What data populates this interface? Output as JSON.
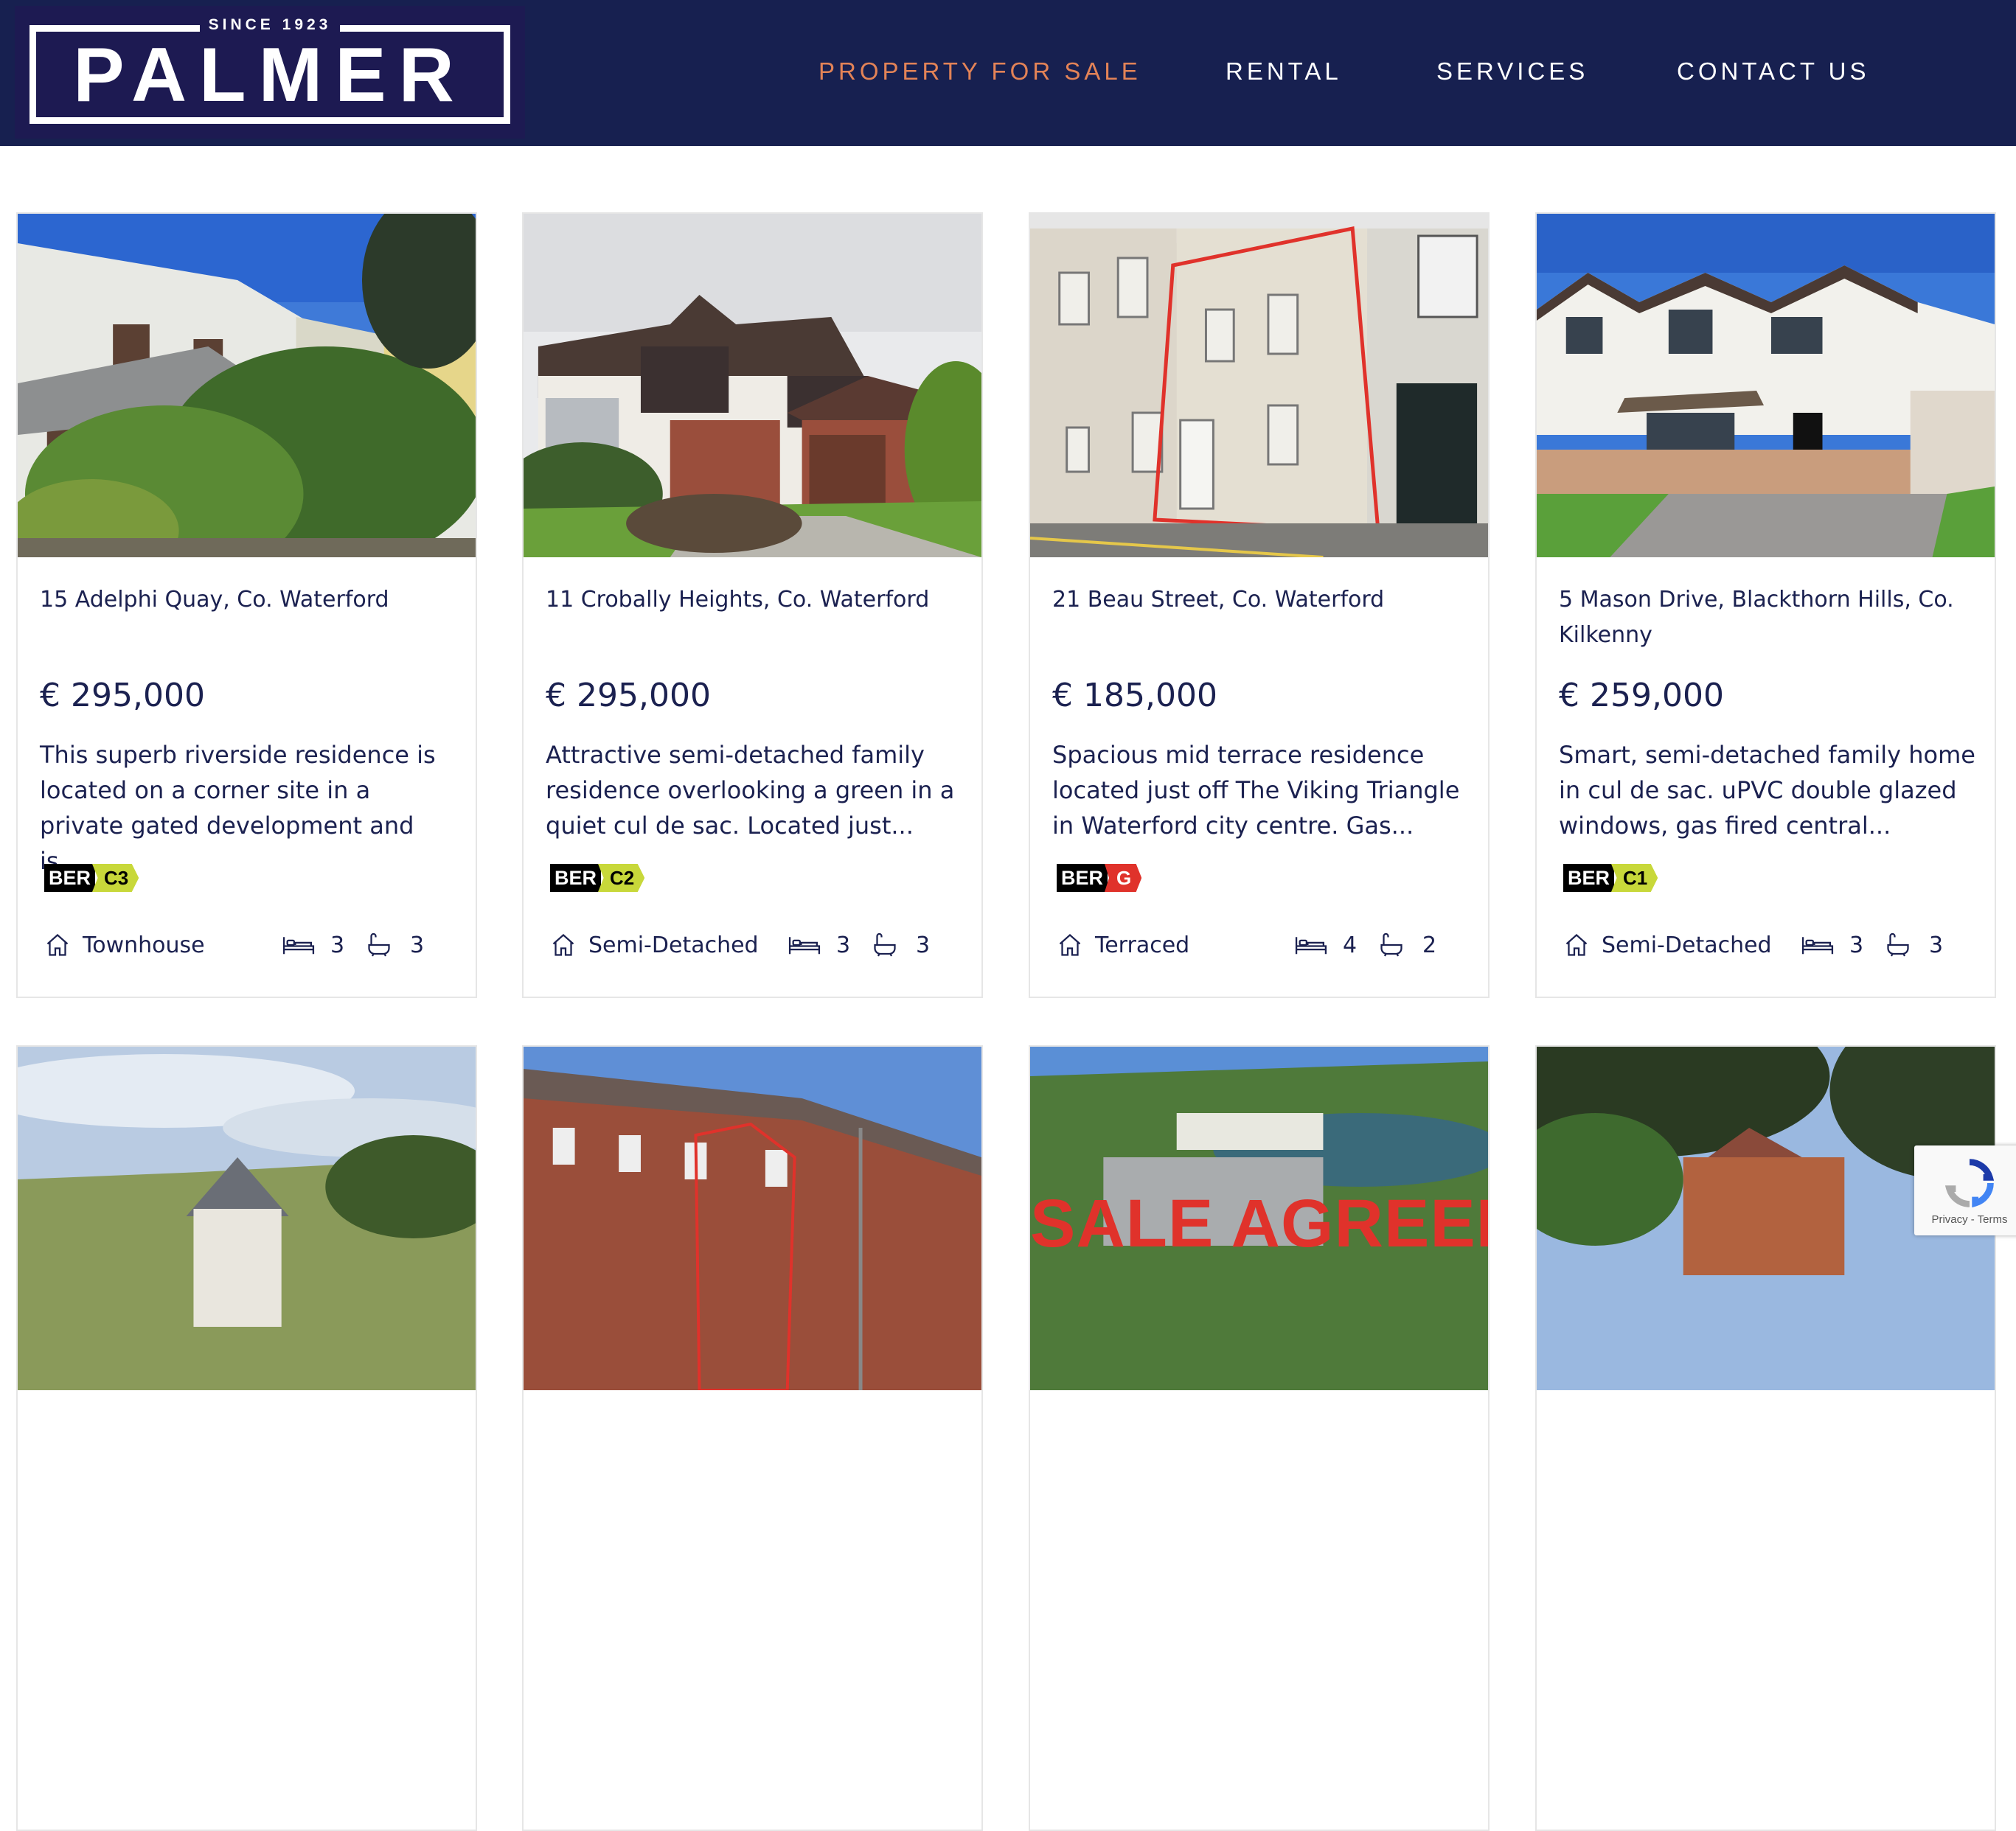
{
  "brand": {
    "name": "PALMER",
    "since": "SINCE 1923"
  },
  "nav": {
    "items": [
      {
        "label": "PROPERTY FOR SALE",
        "active": true
      },
      {
        "label": "RENTAL",
        "active": false
      },
      {
        "label": "SERVICES",
        "active": false
      },
      {
        "label": "CONTACT US",
        "active": false
      }
    ]
  },
  "colors": {
    "header_bg": "#172050",
    "active_nav": "#e38357",
    "text": "#1b2150"
  },
  "listings": [
    {
      "address": "15 Adelphi Quay, Co. Waterford",
      "price": "€ 295,000",
      "description": "This superb riverside residence is located on a corner site in a private gated development and is...",
      "ber_label": "BER",
      "ber_rating": "C3",
      "ber_color": "#c8d83a",
      "type": "Townhouse",
      "beds": "3",
      "baths": "3"
    },
    {
      "address": "11 Crobally Heights, Co. Waterford",
      "price": "€ 295,000",
      "description": "Attractive semi-detached family residence overlooking a green in a quiet cul de sac. Located just...",
      "ber_label": "BER",
      "ber_rating": "C2",
      "ber_color": "#c8d83a",
      "type": "Semi-Detached",
      "beds": "3",
      "baths": "3"
    },
    {
      "address": "21 Beau Street, Co. Waterford",
      "price": "€ 185,000",
      "description": "Spacious mid terrace residence located just off The Viking Triangle in Waterford city centre. Gas...",
      "ber_label": "BER",
      "ber_rating": "G",
      "ber_color": "#e0322b",
      "type": "Terraced",
      "beds": "4",
      "baths": "2"
    },
    {
      "address": "5 Mason Drive, Blackthorn Hills, Co. Kilkenny",
      "price": "€ 259,000",
      "description": "Smart, semi-detached family home in cul de sac. uPVC double glazed windows, gas fired central...",
      "ber_label": "BER",
      "ber_rating": "C1",
      "ber_color": "#c8d83a",
      "type": "Semi-Detached",
      "beds": "3",
      "baths": "3"
    }
  ],
  "second_row": {
    "overlay_text": "SALE AGREED"
  },
  "recaptcha": {
    "text": "Privacy - Terms"
  },
  "icons": {
    "type": "house-icon",
    "beds": "bed-icon",
    "baths": "bath-icon"
  }
}
